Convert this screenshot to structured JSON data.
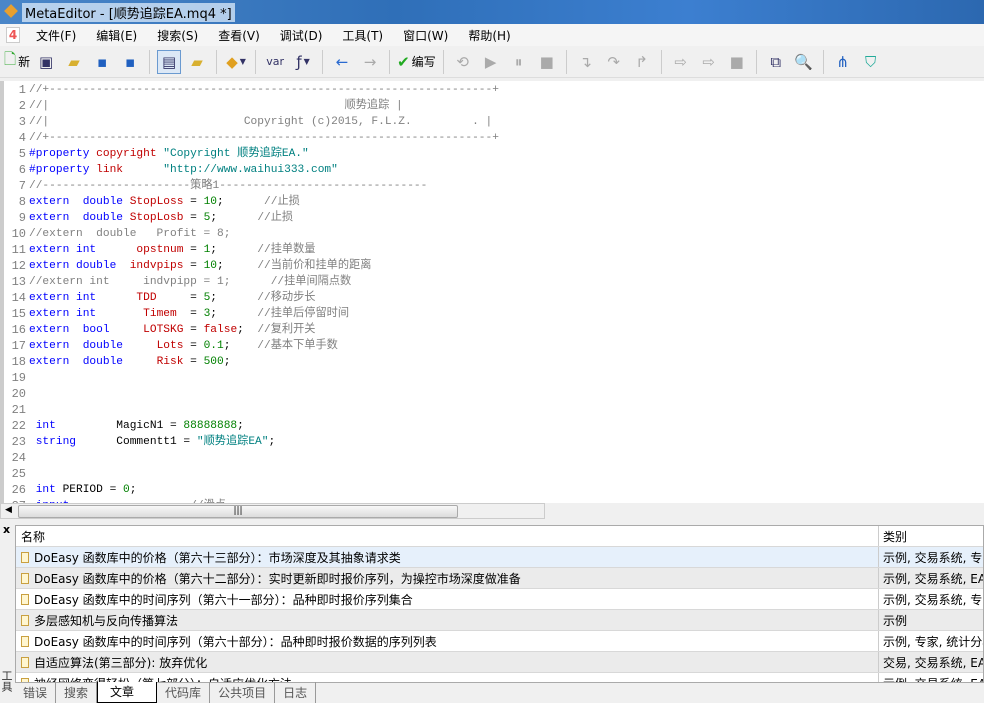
{
  "window": {
    "title": "MetaEditor - [顺势追踪EA.mq4 *]"
  },
  "menu": [
    "文件(F)",
    "编辑(E)",
    "搜索(S)",
    "查看(V)",
    "调试(D)",
    "工具(T)",
    "窗口(W)",
    "帮助(H)"
  ],
  "toolbar": {
    "new_label": "新",
    "compile_label": "编写"
  },
  "editor": {
    "lines": [
      [
        [
          "cm",
          "//+------------------------------------------------------------------+"
        ]
      ],
      [
        [
          "cm",
          "//|                                            顺势追踪 |"
        ]
      ],
      [
        [
          "cm",
          "//|                             Copyright (c)2015, F.L.Z.         . |"
        ]
      ],
      [
        [
          "cm",
          "//+------------------------------------------------------------------+"
        ]
      ],
      [
        [
          "kw",
          "#property "
        ],
        [
          "vr",
          "copyright "
        ],
        [
          "st",
          "\"Copyright 顺势追踪EA.\""
        ]
      ],
      [
        [
          "kw",
          "#property "
        ],
        [
          "vr",
          "link"
        ],
        [
          "st",
          "      \"http://www.waihui333.com\""
        ]
      ],
      [
        [
          "cm",
          "//----------------------策略1-------------------------------"
        ]
      ],
      [
        [
          "kw",
          "extern  double "
        ],
        [
          "vr",
          "StopLoss"
        ],
        [
          "",
          " = "
        ],
        [
          "nm",
          "10"
        ],
        [
          "",
          ";"
        ],
        [
          "cm",
          "      //止损"
        ]
      ],
      [
        [
          "kw",
          "extern  double "
        ],
        [
          "vr",
          "StopLosb"
        ],
        [
          "",
          " = "
        ],
        [
          "nm",
          "5"
        ],
        [
          "",
          ";"
        ],
        [
          "cm",
          "      //止损"
        ]
      ],
      [
        [
          "cm",
          "//extern  double   Profit = 8;"
        ]
      ],
      [
        [
          "kw",
          "extern int      "
        ],
        [
          "vr",
          "opstnum"
        ],
        [
          "",
          " = "
        ],
        [
          "nm",
          "1"
        ],
        [
          "",
          ";"
        ],
        [
          "cm",
          "      //挂单数量"
        ]
      ],
      [
        [
          "kw",
          "extern double  "
        ],
        [
          "vr",
          "indvpips"
        ],
        [
          "",
          " = "
        ],
        [
          "nm",
          "10"
        ],
        [
          "",
          ";"
        ],
        [
          "cm",
          "     //当前价和挂单的距离"
        ]
      ],
      [
        [
          "cm",
          "//extern int     indvpipp = 1;      //挂单间隔点数"
        ]
      ],
      [
        [
          "kw",
          "extern int      "
        ],
        [
          "vr",
          "TDD"
        ],
        [
          "",
          "     = "
        ],
        [
          "nm",
          "5"
        ],
        [
          "",
          ";"
        ],
        [
          "cm",
          "      //移动步长"
        ]
      ],
      [
        [
          "kw",
          "extern int       "
        ],
        [
          "vr",
          "Timem"
        ],
        [
          "",
          "  = "
        ],
        [
          "nm",
          "3"
        ],
        [
          "",
          ";"
        ],
        [
          "cm",
          "      //挂单后停留时间"
        ]
      ],
      [
        [
          "kw",
          "extern  bool     "
        ],
        [
          "vr",
          "LOTSKG"
        ],
        [
          "",
          " = "
        ],
        [
          "vr",
          "false"
        ],
        [
          "",
          ";"
        ],
        [
          "cm",
          "  //复利开关"
        ]
      ],
      [
        [
          "kw",
          "extern  double     "
        ],
        [
          "vr",
          "Lots"
        ],
        [
          "",
          " = "
        ],
        [
          "nm",
          "0.1"
        ],
        [
          "",
          ";"
        ],
        [
          "cm",
          "    //基本下单手数"
        ]
      ],
      [
        [
          "kw",
          "extern  double     "
        ],
        [
          "vr",
          "Risk"
        ],
        [
          "",
          " = "
        ],
        [
          "nm",
          "500"
        ],
        [
          "",
          ";"
        ]
      ],
      [],
      [],
      [],
      [
        [
          "kw",
          " int"
        ],
        [
          "",
          "         MagicN1 = "
        ],
        [
          "nm",
          "88888888"
        ],
        [
          "",
          ";"
        ]
      ],
      [
        [
          "kw",
          " string"
        ],
        [
          "",
          "      Commentt1 = "
        ],
        [
          "st",
          "\"顺势追踪EA\""
        ],
        [
          "",
          ";"
        ]
      ],
      [],
      [],
      [
        [
          "kw",
          " int"
        ],
        [
          "",
          " PERIOD = "
        ],
        [
          "nm",
          "0"
        ],
        [
          "",
          ";"
        ]
      ],
      [
        [
          "kw",
          " input"
        ],
        [
          "",
          "               "
        ],
        [
          "cm",
          "   //滑点"
        ]
      ]
    ]
  },
  "panel": {
    "close": "x",
    "side_label": "工具箱",
    "columns": [
      "名称",
      "类别"
    ],
    "rows": [
      [
        "DoEasy 函数库中的价格（第六十三部分）：市场深度及其抽象请求类",
        "示例, 交易系统, 专家"
      ],
      [
        "DoEasy 函数库中的价格（第六十二部分）：实时更新即时报价序列，为操控市场深度做准备",
        "示例, 交易系统, EA"
      ],
      [
        "DoEasy 函数库中的时间序列（第六十一部分）：品种即时报价序列集合",
        "示例, 交易系统, 专家"
      ],
      [
        "多层感知机与反向传播算法",
        "示例"
      ],
      [
        "DoEasy 函数库中的时间序列（第六十部分）：品种即时报价数据的序列列表",
        "示例, 专家, 统计分析"
      ],
      [
        "自适应算法(第三部分): 放弃优化",
        "交易, 交易系统, EA"
      ],
      [
        "神经网络变得轻松（第七部分）：自适应优化方法",
        "示例, 交易系统, EA"
      ]
    ],
    "tabs": [
      "错误",
      "搜索",
      "文章",
      "代码库",
      "公共项目",
      "日志"
    ],
    "active_tab": 2
  },
  "colors": {
    "keyword": "#0000ff",
    "variable": "#c00000",
    "number": "#008000",
    "comment": "#808080",
    "string": "#008080",
    "selected_row": "#e6f0fb"
  }
}
